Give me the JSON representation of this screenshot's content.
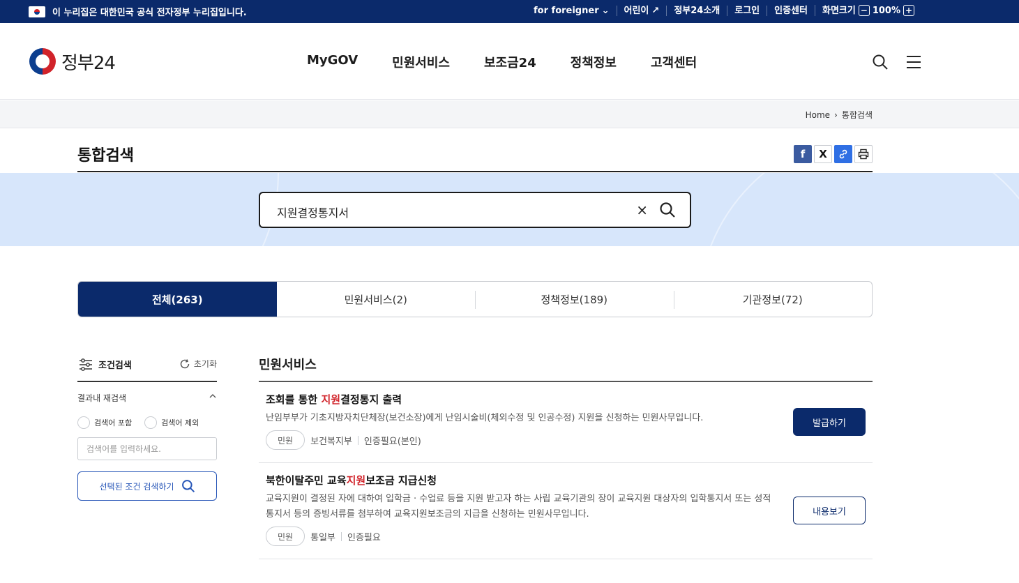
{
  "topbar": {
    "notice": "이 누리집은 대한민국 공식 전자정부 누리집입니다.",
    "utils": [
      "for foreigner",
      "어린이",
      "정부24소개",
      "로그인",
      "인증센터",
      "화면크기"
    ],
    "zoom_value": "100%",
    "zoom_minus": "−",
    "zoom_plus": "+"
  },
  "header": {
    "logo_text": "정부24",
    "nav": [
      "MyGOV",
      "민원서비스",
      "보조금24",
      "정책정보",
      "고객센터"
    ]
  },
  "breadcrumb": {
    "home": "Home",
    "separator": "›",
    "current": "통합검색"
  },
  "page": {
    "title": "통합검색"
  },
  "share": {
    "facebook": "f",
    "x": "X",
    "link": "🔗",
    "print": "⎙"
  },
  "search": {
    "value": "지원결정통지서",
    "clear": "×"
  },
  "tabs": [
    {
      "label": "전체(263)",
      "active": true
    },
    {
      "label": "민원서비스(2)",
      "active": false
    },
    {
      "label": "정책정보(189)",
      "active": false
    },
    {
      "label": "기관정보(72)",
      "active": false
    }
  ],
  "filter": {
    "title": "조건검색",
    "reset": "초기화",
    "section": "결과내 재검색",
    "include": "검색어 포함",
    "exclude": "검색어 제외",
    "placeholder": "검색어를 입력하세요.",
    "button": "선택된 조건 검색하기"
  },
  "results": {
    "heading": "민원서비스",
    "items": [
      {
        "title_pre": "조회를 통한 ",
        "title_hl": "지원",
        "title_post": "결정통지 출력",
        "desc": "난임부부가 기초지방자치단체장(보건소장)에게 난임시술비(체외수정 및 인공수정) 지원을 신청하는 민원사무입니다.",
        "type": "민원",
        "org": "보건복지부",
        "auth": "인증필요(본인)",
        "action": "발급하기"
      },
      {
        "title_pre": "북한이탈주민 교육",
        "title_hl": "지원",
        "title_post": "보조금 지급신청",
        "desc": "교육지원이 결정된 자에 대하여 입학금 · 수업료 등을 지원 받고자 하는 사립 교육기관의 장이 교육지원 대상자의 입학통지서 또는 성적통지서 등의 증빙서류를 첨부하여 교육지원보조금의 지급을 신청하는 민원사무입니다.",
        "type": "민원",
        "org": "통일부",
        "auth": "인증필요",
        "action": "내용보기"
      }
    ]
  },
  "colors": {
    "navy": "#0b2a6b",
    "highlight": "#d1232a",
    "band": "#d7e6fb"
  }
}
